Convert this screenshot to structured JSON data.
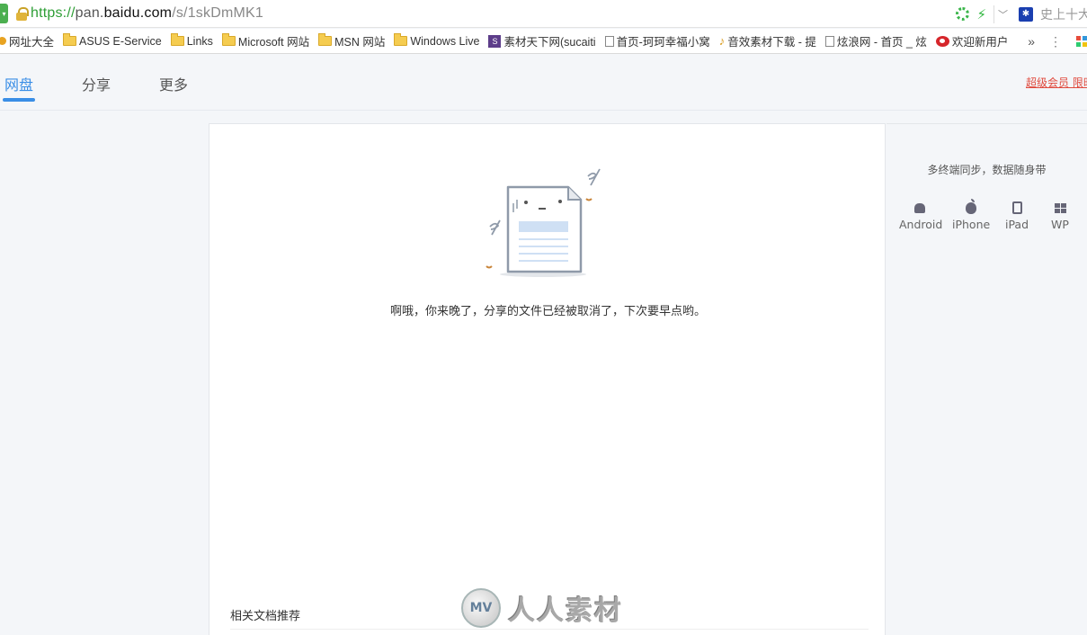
{
  "browser": {
    "url": {
      "scheme": "https://",
      "subdomain": "pan.",
      "domain": "baidu.com",
      "path": "/s/1skDmMK1"
    },
    "search_hint": "史上十大",
    "bookmarks": [
      {
        "label": "网址大全",
        "icon": "dot-icon"
      },
      {
        "label": "ASUS E-Service",
        "icon": "folder-icon"
      },
      {
        "label": "Links",
        "icon": "folder-icon"
      },
      {
        "label": "Microsoft 网站",
        "icon": "folder-icon"
      },
      {
        "label": "MSN 网站",
        "icon": "folder-icon"
      },
      {
        "label": "Windows Live",
        "icon": "folder-icon"
      },
      {
        "label": "素材天下网(sucaiti",
        "icon": "su-icon"
      },
      {
        "label": "首页-珂珂幸福小窝",
        "icon": "page-icon"
      },
      {
        "label": "音效素材下载 - 提",
        "icon": "music-icon"
      },
      {
        "label": "炫浪网 - 首页 _ 炫",
        "icon": "page-icon"
      },
      {
        "label": "欢迎新用户",
        "icon": "weibo-icon"
      }
    ],
    "more_symbol": "»",
    "menu_symbol": "⋮"
  },
  "header": {
    "tabs": [
      {
        "label": "网盘",
        "active": true
      },
      {
        "label": "分享",
        "active": false
      },
      {
        "label": "更多",
        "active": false
      }
    ],
    "vip_link": "超级会员 限时"
  },
  "main": {
    "message": "啊哦，你来晚了，分享的文件已经被取消了，下次要早点哟。",
    "related_title": "相关文档推荐"
  },
  "sidebar": {
    "title": "多终端同步，数据随身带",
    "platforms": [
      {
        "label": "Android",
        "icon": "android-icon"
      },
      {
        "label": "iPhone",
        "icon": "apple-icon"
      },
      {
        "label": "iPad",
        "icon": "ipad-icon"
      },
      {
        "label": "WP",
        "icon": "windows-icon"
      }
    ]
  },
  "watermark": {
    "logo": "MV",
    "text": "人人素材"
  },
  "colors": {
    "accent": "#3a8ee6",
    "vip_link": "#e0493d",
    "page_bg": "#f4f6f9"
  }
}
